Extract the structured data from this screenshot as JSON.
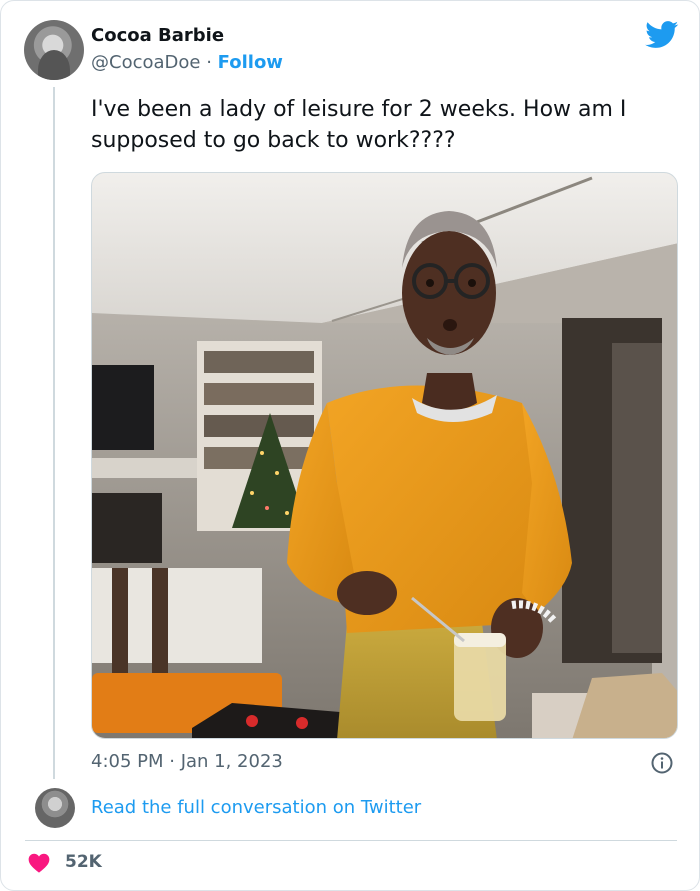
{
  "tweet": {
    "author_name": "Cocoa Barbie",
    "handle": "@CocoaDoe",
    "separator": "·",
    "follow_label": "Follow",
    "text": "I've been a lady of leisure for 2 weeks. How am I supposed to go back to work????",
    "timestamp": "4:05 PM · Jan 1, 2023",
    "read_more_label": "Read the full conversation on Twitter",
    "like_count": "52K"
  },
  "icons": {
    "brand": "twitter-bird-icon",
    "info": "info-icon",
    "like": "heart-icon"
  },
  "colors": {
    "accent": "#1d9bf0",
    "like": "#f91880",
    "secondary_text": "#536471"
  }
}
